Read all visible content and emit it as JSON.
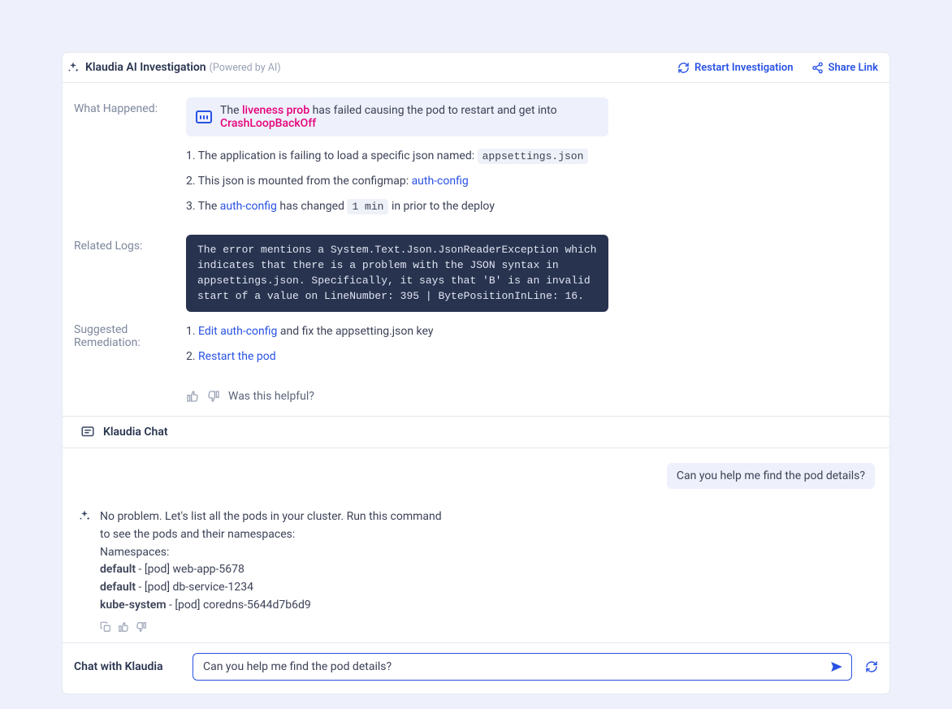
{
  "header": {
    "title": "Klaudia AI Investigation",
    "subtitle": "(Powered by AI)",
    "restart_label": "Restart Investigation",
    "share_label": "Share Link"
  },
  "labels": {
    "what_happened": "What Happened:",
    "related_logs": "Related Logs:",
    "suggested_remediation": "Suggested Remediation:",
    "feedback_prompt": "Was this helpful?",
    "chat_header": "Klaudia Chat",
    "chat_footer": "Chat with Klaudia"
  },
  "summary": {
    "prefix": "The ",
    "hot1": "liveness prob",
    "mid": " has failed causing the pod to restart and get into ",
    "hot2": "CrashLoopBackOff"
  },
  "what_happened_items": {
    "i1_a": "The application is failing to load a specific json named: ",
    "i1_code": "appsettings.json",
    "i2_a": "This json is mounted from the configmap: ",
    "i2_link": "auth-config",
    "i3_a": "The ",
    "i3_link": "auth-config",
    "i3_b": " has changed ",
    "i3_code": "1 min",
    "i3_c": " in  prior to the deploy"
  },
  "related_logs": "The error mentions a System.Text.Json.JsonReaderException which indicates that there is a problem with the JSON syntax in appsettings.json. Specifically, it says that 'B' is an invalid start of a value on LineNumber: 395 | BytePositionInLine: 16.",
  "remediation": {
    "r1_link": "Edit auth-config",
    "r1_rest": " and fix the appsetting.json key",
    "r2_link": "Restart the pod"
  },
  "chat": {
    "user_msg": "Can you help me find the pod details?",
    "ai_intro": "No problem. Let's list all the pods in your cluster. Run this command to see the pods and their namespaces:",
    "ns_label": "Namespaces:",
    "rows": {
      "r1a": "default",
      "r1b": " - [pod] web-app-5678",
      "r2a": "default",
      "r2b": " - [pod] db-service-1234",
      "r3a": "kube-system",
      "r3b": " - [pod] coredns-5644d7b6d9"
    }
  },
  "input": {
    "value": "Can you help me find the pod details?"
  }
}
